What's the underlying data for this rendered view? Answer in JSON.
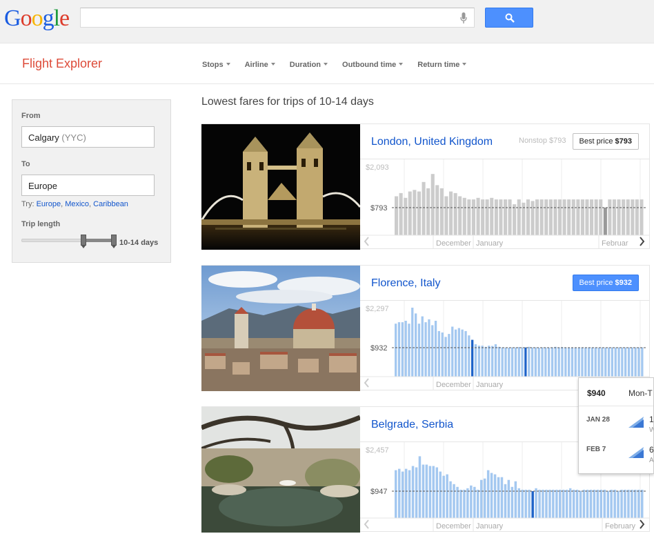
{
  "header": {
    "logo": [
      "G",
      "o",
      "o",
      "g",
      "l",
      "e"
    ],
    "logo_colors": [
      "#1a5ce1",
      "#dd3c2b",
      "#f7b500",
      "#1a5ce1",
      "#1d9a3d",
      "#dd3c2b"
    ],
    "search_value": "",
    "search_button_icon": "search-icon"
  },
  "app": {
    "title": "Flight Explorer",
    "filters": [
      "Stops",
      "Airline",
      "Duration",
      "Outbound time",
      "Return time"
    ]
  },
  "sidebar": {
    "from_label": "From",
    "from_city": "Calgary",
    "from_code": "(YYC)",
    "to_label": "To",
    "to_value": "Europe",
    "try_label": "Try:",
    "try_links": [
      "Europe",
      "Mexico",
      "Caribbean"
    ],
    "trip_length_label": "Trip length",
    "trip_length_value": "10-14 days",
    "trip_length_range": [
      10,
      14
    ]
  },
  "results": {
    "title": "Lowest fares for trips of 10-14 days",
    "cards": [
      {
        "destination": "London, United Kingdom",
        "nonstop": "Nonstop $793",
        "best_label": "Best price",
        "best_price": "$793",
        "best_highlight": false,
        "y_max": "$2,093",
        "y_ref": "$793",
        "months": [
          "December",
          "January",
          "Februar"
        ]
      },
      {
        "destination": "Florence, Italy",
        "nonstop": "",
        "best_label": "Best price",
        "best_price": "$932",
        "best_highlight": true,
        "y_max": "$2,297",
        "y_ref": "$932",
        "months": [
          "December",
          "January"
        ]
      },
      {
        "destination": "Belgrade, Serbia",
        "nonstop": "",
        "best_label": "",
        "best_price": "",
        "best_highlight": false,
        "y_max": "$2,457",
        "y_ref": "$947",
        "months": [
          "December",
          "January",
          "February"
        ]
      }
    ]
  },
  "tooltip": {
    "price": "$940",
    "days": "Mon-T",
    "legs": [
      {
        "date": "JAN 28",
        "num": "1",
        "sub": "W"
      },
      {
        "date": "FEB 7",
        "num": "6",
        "sub": "A"
      }
    ]
  },
  "chart_data": [
    {
      "type": "bar",
      "title": "London, United Kingdom",
      "ylim": [
        0,
        2093
      ],
      "reference_line": 793,
      "color": "#cccccc",
      "highlight_color": "#999999",
      "highlight_index": [
        46
      ],
      "values": [
        1150,
        1250,
        1100,
        1300,
        1350,
        1300,
        1600,
        1400,
        1850,
        1500,
        1400,
        1150,
        1300,
        1250,
        1150,
        1100,
        1050,
        1050,
        1100,
        1050,
        1050,
        1100,
        1050,
        1050,
        1050,
        1050,
        900,
        1050,
        950,
        1050,
        1000,
        1050,
        1050,
        1050,
        1050,
        1050,
        1050,
        1050,
        1050,
        1050,
        1050,
        1050,
        1050,
        1050,
        1050,
        1050,
        793,
        1050,
        1050,
        1050,
        1050,
        1050,
        1050,
        1050,
        1050
      ]
    },
    {
      "type": "bar",
      "title": "Florence, Italy",
      "ylim": [
        0,
        2297
      ],
      "reference_line": 932,
      "color": "#a4c8f0",
      "highlight_color": "#1e63c9",
      "highlight_index": [
        23,
        39
      ],
      "values": [
        1750,
        1800,
        1800,
        1850,
        1750,
        2297,
        2100,
        1750,
        2000,
        1800,
        1900,
        1700,
        1850,
        1500,
        1450,
        1300,
        1400,
        1650,
        1550,
        1600,
        1550,
        1500,
        1350,
        1200,
        1050,
        1000,
        1000,
        960,
        1000,
        990,
        1050,
        960,
        940,
        932,
        932,
        940,
        940,
        950,
        940,
        940,
        960,
        940,
        940,
        932,
        940,
        940,
        932,
        940,
        960,
        940,
        950,
        940,
        940,
        932,
        940,
        940,
        940,
        940,
        940,
        940,
        940,
        932,
        940,
        932,
        940,
        940,
        940,
        940,
        940,
        940,
        940,
        940,
        940,
        940,
        940
      ]
    },
    {
      "type": "bar",
      "title": "Belgrade, Serbia",
      "ylim": [
        0,
        2457
      ],
      "reference_line": 947,
      "color": "#a4c8f0",
      "highlight_color": "#1e63c9",
      "highlight_index": [
        40
      ],
      "values": [
        1700,
        1750,
        1650,
        1750,
        1700,
        1850,
        1800,
        2200,
        1900,
        1900,
        1850,
        1850,
        1800,
        1650,
        1500,
        1550,
        1300,
        1200,
        1100,
        1000,
        1000,
        1050,
        1150,
        1100,
        1000,
        1350,
        1400,
        1700,
        1600,
        1550,
        1450,
        1450,
        1200,
        1350,
        1100,
        1300,
        1050,
        1000,
        1000,
        1000,
        947,
        1050,
        1000,
        1000,
        1000,
        1000,
        1000,
        1000,
        1000,
        1000,
        1000,
        1050,
        1000,
        1000,
        960,
        1000,
        1000,
        1000,
        1000,
        1000,
        1000,
        1000,
        960,
        1000,
        1000,
        960,
        1000,
        1000,
        1000,
        1000,
        1000,
        1000,
        1000
      ]
    }
  ]
}
